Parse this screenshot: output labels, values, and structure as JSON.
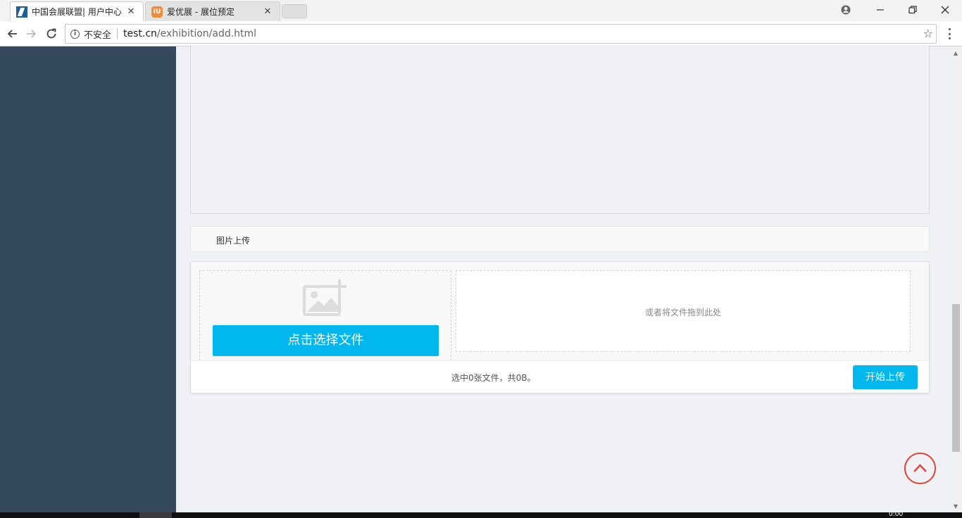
{
  "browser": {
    "tabs": [
      {
        "title": "中国会展联盟| 用户中心",
        "favicon": "logo-icon",
        "active": true
      },
      {
        "title": "爱优展 - 展位预定",
        "favicon": "IU",
        "active": false
      }
    ],
    "close_glyph": "✕",
    "address": {
      "security_label": "不安全",
      "host": "test.cn",
      "path": "/exhibition/add.html"
    }
  },
  "upload": {
    "section_title": "图片上传",
    "pick_button_label": "点击选择文件",
    "drop_hint": "或者将文件拖到此处",
    "status_text": "选中0张文件，共0B。",
    "start_button_label": "开始上传"
  },
  "taskbar": {
    "clock": "0:00"
  },
  "colors": {
    "sidebar": "#34495c",
    "accent": "#00b7ee",
    "back_top": "#e0463c"
  }
}
